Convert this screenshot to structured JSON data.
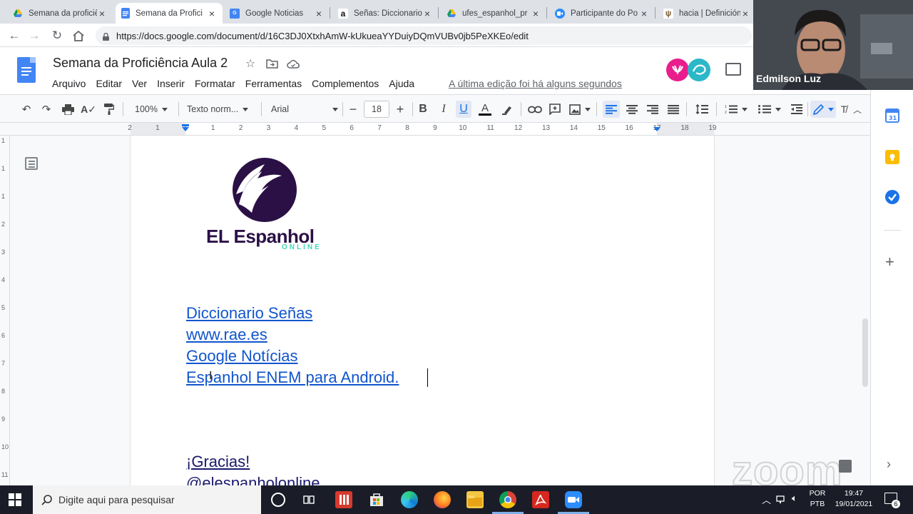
{
  "browser": {
    "tabs": [
      {
        "title": "Semana da proficiê",
        "favicon": "google-drive-icon",
        "active": false
      },
      {
        "title": "Semana da Profici",
        "favicon": "google-docs-icon",
        "active": true
      },
      {
        "title": "Google Noticias",
        "favicon": "google-news-icon",
        "active": false
      },
      {
        "title": "Señas: Diccionario",
        "favicon": "amazon-icon",
        "active": false
      },
      {
        "title": "ufes_espanhol_pr",
        "favicon": "google-drive-icon",
        "active": false
      },
      {
        "title": "Participante do Po",
        "favicon": "zoom-icon",
        "active": false
      },
      {
        "title": "hacia | Definición",
        "favicon": "rae-icon",
        "active": false
      }
    ],
    "url": "https://docs.google.com/document/d/16C3DJ0XtxhAmW-kUkueaYYDuiyDQmVUBv0jb5PeXKEo/edit"
  },
  "docs": {
    "title": "Semana da Proficiência Aula 2",
    "menu": [
      "Arquivo",
      "Editar",
      "Ver",
      "Inserir",
      "Formatar",
      "Ferramentas",
      "Complementos",
      "Ajuda"
    ],
    "last_edit": "A última edição foi há alguns segundos",
    "toolbar": {
      "zoom": "100%",
      "style": "Texto norm...",
      "font": "Arial",
      "font_size": "18"
    },
    "ruler_numbers": [
      "2",
      "1",
      "1",
      "1",
      "2",
      "3",
      "4",
      "5",
      "6",
      "7",
      "8",
      "9",
      "10",
      "11",
      "12",
      "13",
      "14",
      "15",
      "16",
      "17",
      "18",
      "19"
    ],
    "vruler_numbers": [
      "1",
      "1",
      "1",
      "2",
      "3",
      "4",
      "5",
      "6",
      "7",
      "8",
      "9",
      "10",
      "11"
    ],
    "logo_text": "EL Espanhol",
    "logo_subtext": "ONLINE",
    "links": [
      "Diccionario Señas",
      "www.rae.es",
      "Google Notícias",
      "Espanhol ENEM para Android."
    ],
    "gracias": "¡Gracias!",
    "handle": "@elespanholonline"
  },
  "webcam": {
    "name": "Edmilson Luz"
  },
  "watermark": "zoom",
  "taskbar": {
    "search_placeholder": "Digite aqui para pesquisar",
    "lang_top": "POR",
    "lang_bottom": "PTB",
    "time": "19:47",
    "date": "19/01/2021",
    "notif_count": "6"
  },
  "colors": {
    "link": "#1155cc",
    "docs_blue": "#4285f4",
    "logo_purple": "#2b1046",
    "logo_teal": "#45d6b5"
  }
}
